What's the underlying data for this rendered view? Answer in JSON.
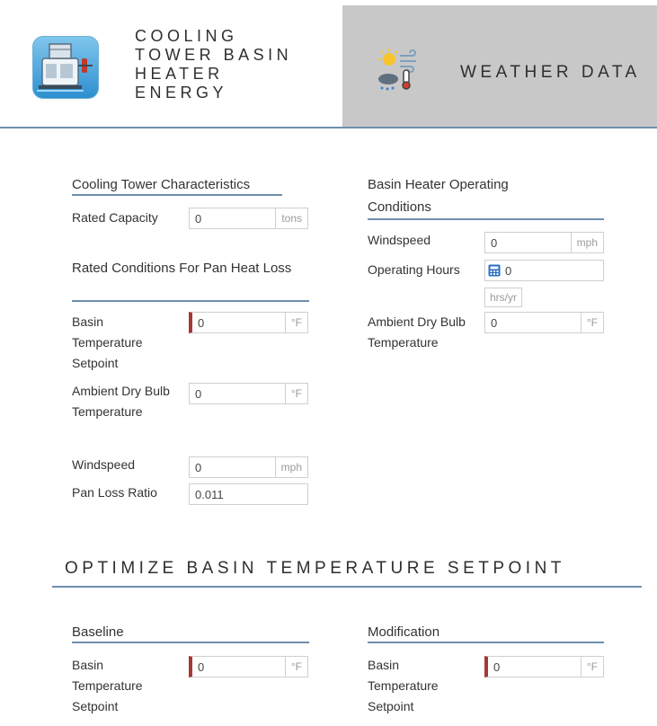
{
  "header": {
    "app_title_lines": [
      "COOLING",
      "TOWER BASIN",
      "HEATER",
      "ENERGY"
    ],
    "weather_tab_label": "WEATHER DATA",
    "icons": {
      "app": "cooling-tower-icon",
      "weather": "weather-icon"
    },
    "colors": {
      "accent": "#6d8fae",
      "inactive_tab": "#c8c8c8",
      "required": "#a33a34"
    }
  },
  "cooling_tower": {
    "title": "Cooling Tower Characteristics",
    "rated_capacity": {
      "label": "Rated Capacity",
      "value": "0",
      "unit": "tons"
    }
  },
  "pan_heat_loss": {
    "title": "Rated Conditions For Pan Heat Loss",
    "basin_temp": {
      "label": "Basin Temperature Setpoint",
      "value": "0",
      "unit": "°F"
    },
    "ambient_dry_bulb": {
      "label": "Ambient Dry Bulb Temperature",
      "value": "0",
      "unit": "°F"
    },
    "windspeed": {
      "label": "Windspeed",
      "value": "0",
      "unit": "mph"
    },
    "pan_loss_ratio": {
      "label": "Pan Loss Ratio",
      "value": "0.011"
    }
  },
  "operating_conditions": {
    "title": "Basin Heater Operating Conditions",
    "windspeed": {
      "label": "Windspeed",
      "value": "0",
      "unit": "mph"
    },
    "operating_hours": {
      "label": "Operating Hours",
      "value": "0",
      "unit": "hrs/yr"
    },
    "ambient_dry_bulb": {
      "label": "Ambient Dry Bulb Temperature",
      "value": "0",
      "unit": "°F"
    }
  },
  "optimize": {
    "title": "OPTIMIZE BASIN TEMPERATURE SETPOINT",
    "baseline": {
      "title": "Baseline",
      "label": "Basin Temperature Setpoint",
      "value": "0",
      "unit": "°F"
    },
    "modification": {
      "title": "Modification",
      "label": "Basin Temperature Setpoint",
      "value": "0",
      "unit": "°F"
    }
  }
}
